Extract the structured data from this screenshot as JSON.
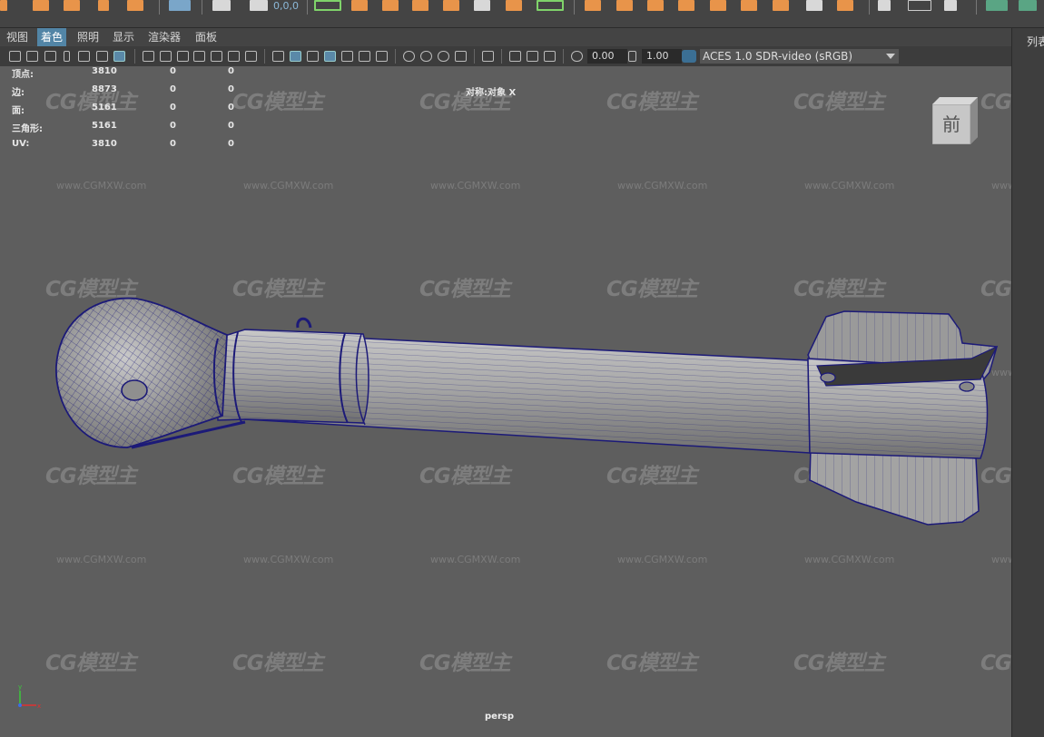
{
  "shelf": {
    "coords_label": "0,0,0"
  },
  "panel_menu": {
    "items": [
      "视图",
      "着色",
      "照明",
      "显示",
      "渲染器",
      "面板"
    ],
    "active_index": 1
  },
  "toolbar": {
    "exposure_value": "0.00",
    "gamma_value": "1.00",
    "color_management": "ACES 1.0 SDR-video (sRGB)"
  },
  "hud": {
    "stats": [
      {
        "label": "顶点:",
        "a": "3810",
        "b": "0",
        "c": "0"
      },
      {
        "label": "边:",
        "a": "8873",
        "b": "0",
        "c": "0"
      },
      {
        "label": "面:",
        "a": "5161",
        "b": "0",
        "c": "0"
      },
      {
        "label": "三角形:",
        "a": "5161",
        "b": "0",
        "c": "0"
      },
      {
        "label": "UV:",
        "a": "3810",
        "b": "0",
        "c": "0"
      }
    ],
    "symmetry_label": "对称:对象 X",
    "camera_label": "persp"
  },
  "viewcube": {
    "face_label": "前"
  },
  "right_panel": {
    "label": "列表"
  },
  "watermark": {
    "logo": "CG模型主",
    "url": "www.CGMXW.com"
  },
  "colors": {
    "viewport_bg": "#5e5e5e",
    "wire": "#1c1a78",
    "accent": "#5285a6",
    "shelf_icon": "#e8944a"
  }
}
